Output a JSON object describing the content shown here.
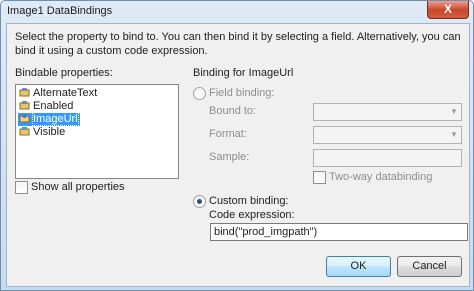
{
  "window": {
    "title": "Image1 DataBindings",
    "close_label": "X"
  },
  "description": "Select the property to bind to. You can then bind it by selecting a field. Alternatively, you can bind it using a custom code expression.",
  "bindable": {
    "label": "Bindable properties:",
    "items": [
      {
        "label": "AlternateText",
        "icon": "property-icon",
        "selected": false
      },
      {
        "label": "Enabled",
        "icon": "property-icon",
        "selected": false
      },
      {
        "label": "ImageUrl",
        "icon": "bound-property-icon",
        "selected": true
      },
      {
        "label": "Visible",
        "icon": "property-icon",
        "selected": false
      }
    ],
    "show_all_label": "Show all properties",
    "show_all_checked": false
  },
  "binding": {
    "header": "Binding for ImageUrl",
    "field_binding_label": "Field binding:",
    "bound_to_label": "Bound to:",
    "format_label": "Format:",
    "sample_label": "Sample:",
    "two_way_label": "Two-way databinding",
    "custom_binding_label": "Custom binding:",
    "custom_binding_selected": true,
    "code_expression_label": "Code expression:",
    "code_expression_value": "bind(\"prod_imgpath\")"
  },
  "buttons": {
    "ok": "OK",
    "cancel": "Cancel"
  }
}
